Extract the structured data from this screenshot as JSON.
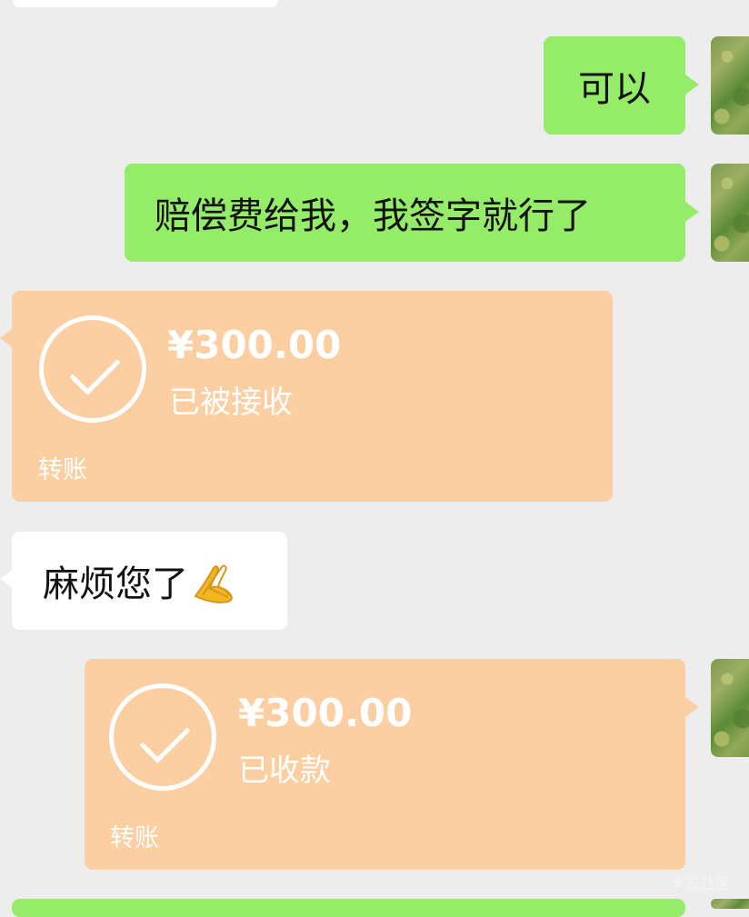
{
  "messages": [
    {
      "text": "可以"
    },
    {
      "text": "赔偿费给我，我签字就行了"
    },
    {
      "type": "transfer",
      "amount": "¥300.00",
      "status": "已被接收",
      "label": "转账"
    },
    {
      "text": "麻烦您了",
      "emoji": "palms-together-icon"
    },
    {
      "type": "transfer",
      "amount": "¥300.00",
      "status": "已收款",
      "label": "转账"
    }
  ],
  "watermark": "卡农社区",
  "colors": {
    "background": "#ededed",
    "sent_bubble": "#95ec69",
    "received_bubble": "#ffffff",
    "transfer_bubble": "#fbcfa1",
    "text": "#111111"
  }
}
